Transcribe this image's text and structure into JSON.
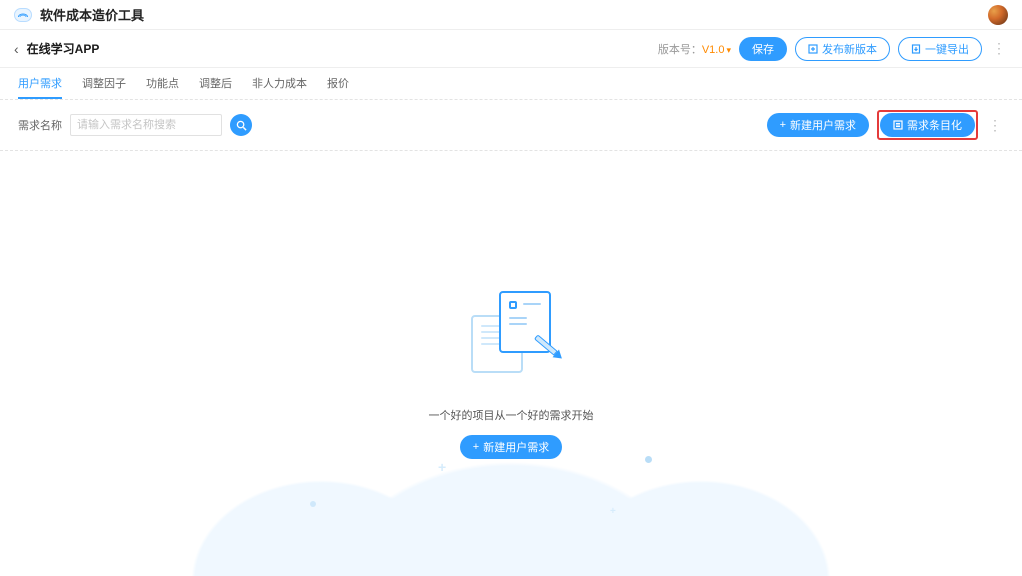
{
  "header": {
    "app_title": "软件成本造价工具"
  },
  "subheader": {
    "page_title": "在线学习APP",
    "version_label": "版本号：",
    "version_value": "V1.0",
    "save_label": "保存",
    "publish_label": "发布新版本",
    "export_label": "一键导出"
  },
  "tabs": [
    {
      "label": "用户需求"
    },
    {
      "label": "调整因子"
    },
    {
      "label": "功能点"
    },
    {
      "label": "调整后"
    },
    {
      "label": "非人力成本"
    },
    {
      "label": "报价"
    }
  ],
  "filter": {
    "name_label": "需求名称",
    "placeholder": "请输入需求名称搜索",
    "new_req_label": "新建用户需求",
    "itemize_label": "需求条目化"
  },
  "empty": {
    "message": "一个好的项目从一个好的需求开始",
    "cta_label": "新建用户需求"
  }
}
